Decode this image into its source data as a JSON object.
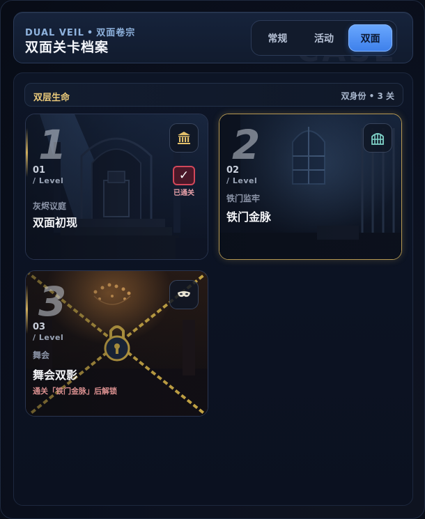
{
  "header": {
    "eyebrow_brand": "DUAL VEIL",
    "eyebrow_dot": "•",
    "eyebrow_sub": "双面卷宗",
    "title": "双面关卡档案",
    "watermark": "CASE",
    "tabs": [
      {
        "label": "常规",
        "active": false
      },
      {
        "label": "活动",
        "active": false
      },
      {
        "label": "双面",
        "active": true
      }
    ]
  },
  "section": {
    "title": "双层生命",
    "meta": "双身份 • 3 关"
  },
  "levels": [
    {
      "big": "1",
      "num": "01",
      "level_label": "/ Level",
      "subtitle": "灰烬议庭",
      "name": "双面初现",
      "icon": "courthouse-icon",
      "cleared": true,
      "cleared_label": "已通关",
      "check": "✓"
    },
    {
      "big": "2",
      "num": "02",
      "level_label": "/ Level",
      "subtitle": "铁门监牢",
      "name": "铁门金脉",
      "icon": "prison-gate-icon",
      "selected": true
    },
    {
      "big": "3",
      "num": "03",
      "level_label": "/ Level",
      "subtitle": "舞会",
      "name": "舞会双影",
      "icon": "mask-icon",
      "locked": true,
      "unlock_hint": "通关「铁门金脉」后解锁"
    }
  ],
  "colors": {
    "accent_gold": "#e9c97a",
    "tab_active": "#4f8ff2",
    "cleared_red": "#d2475a",
    "chain_gold": "#d9b54a"
  }
}
